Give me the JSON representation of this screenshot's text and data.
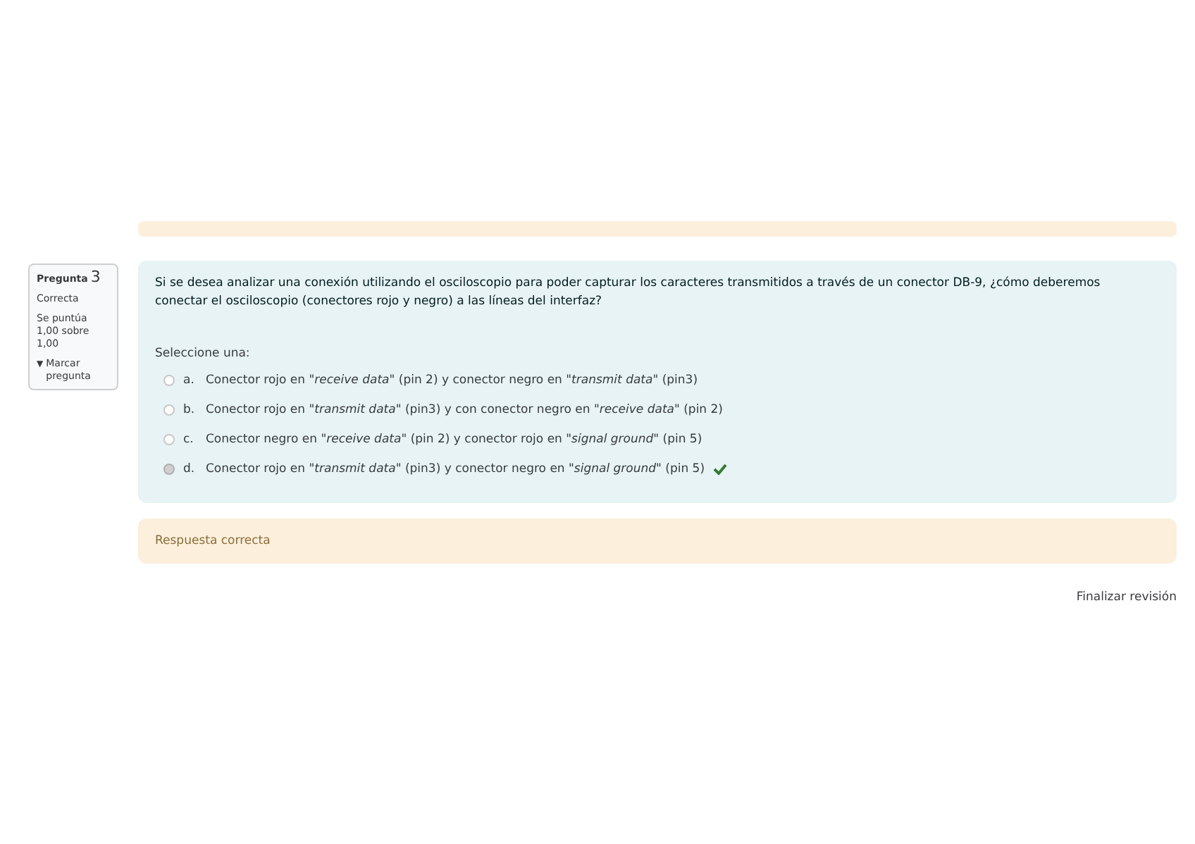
{
  "info": {
    "label": "Pregunta",
    "number": "3",
    "status": "Correcta",
    "score": "Se puntúa 1,00 sobre 1,00",
    "flag_icon": "▼",
    "flag_label": "Marcar pregunta"
  },
  "question": {
    "text": "Si se desea analizar una conexión utilizando el osciloscopio para poder capturar los caracteres transmitidos a través de un conector DB-9, ¿cómo deberemos conectar el osciloscopio (conectores rojo y negro) a las líneas del interfaz?",
    "prompt": "Seleccione una:",
    "options": [
      {
        "letter": "a.",
        "text": "Conector rojo en \"*receive data*\" (pin 2) y conector negro en \"*transmit data*\" (pin3)",
        "selected": false,
        "correct": false
      },
      {
        "letter": "b.",
        "text": "Conector rojo en \"*transmit data*\" (pin3) y con conector negro en \"*receive data*\" (pin 2)",
        "selected": false,
        "correct": false
      },
      {
        "letter": "c.",
        "text": "Conector negro en \"*receive data*\" (pin 2) y conector rojo en \"*signal ground*\" (pin 5)",
        "selected": false,
        "correct": false
      },
      {
        "letter": "d.",
        "text": "Conector rojo en \"*transmit data*\" (pin3) y conector negro en \"*signal ground*\" (pin 5)",
        "selected": true,
        "correct": true
      }
    ]
  },
  "feedback": "Respuesta correcta",
  "finish_link": "Finalizar revisión"
}
